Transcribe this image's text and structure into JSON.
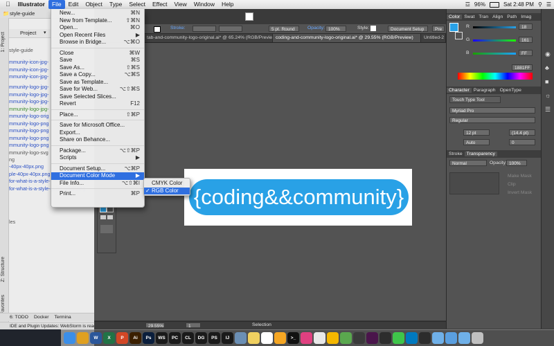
{
  "menubar": {
    "app": "Illustrator",
    "items": [
      "File",
      "Edit",
      "Object",
      "Type",
      "Select",
      "Effect",
      "View",
      "Window",
      "Help"
    ],
    "active": "File",
    "battery": "96%",
    "clock": "Sat 2:48 PM"
  },
  "webstorm": {
    "tab": "style-guide",
    "project_label": "Project",
    "files": [
      {
        "name": "style-guide",
        "cls": "grey"
      },
      {
        "name": "mmunity-icon-jpg-",
        "cls": "blue"
      },
      {
        "name": "mmunity-icon-jpg-",
        "cls": "blue"
      },
      {
        "name": "mmunity-icon-jpg-",
        "cls": "blue"
      },
      {
        "name": "mmunity-logo-jpg-",
        "cls": "blue"
      },
      {
        "name": "mmunity-logo-jpg-",
        "cls": "blue"
      },
      {
        "name": "mmunity-logo-jpg-",
        "cls": "blue"
      },
      {
        "name": "mmunity-logo-jpg-",
        "cls": "green"
      },
      {
        "name": "mmunity-logo-orig",
        "cls": "blue"
      },
      {
        "name": "mmunity-logo-png",
        "cls": "blue"
      },
      {
        "name": "mmunity-logo-png",
        "cls": "blue"
      },
      {
        "name": "mmunity-logo-png",
        "cls": "blue"
      },
      {
        "name": "mmunity-logo-png",
        "cls": "blue"
      },
      {
        "name": "mmunity-logo-svg",
        "cls": "grey"
      },
      {
        "name": "ng",
        "cls": "grey"
      },
      {
        "name": "-40px-40px.png",
        "cls": "blue"
      },
      {
        "name": "ple-40px-40px.png",
        "cls": "blue"
      },
      {
        "name": "for-what-is-a-style-",
        "cls": "blue"
      },
      {
        "name": "for-what-is-a-style-guide-small.png",
        "cls": "blue"
      },
      {
        "name": "les",
        "cls": "grey"
      }
    ],
    "side_labels": [
      "1: Project",
      "Z: Structure",
      "2: Favorites"
    ],
    "bottom_tabs": [
      "6: TODO",
      "Docker",
      "Termina"
    ],
    "status": "IDE and Plugin Updates: WebStorm is read"
  },
  "illustrator": {
    "control": {
      "stroke_label": "Stroke:",
      "pt_round": "5 pt. Round",
      "opacity_label": "Opacity:",
      "opacity": "100%",
      "style_label": "Style:",
      "doc_setup": "Document Setup",
      "pre": "Pre"
    },
    "tabs": [
      {
        "label": "tab-and-community-logo-original.ai* @ 65.24% (RGB/Preview)",
        "on": false
      },
      {
        "label": "coding-and-community-logo-original.ai* @ 29.55% (RGB/Preview)",
        "on": true
      },
      {
        "label": "Untitled-2",
        "on": false
      }
    ],
    "logo_text": "{coding&&community}",
    "logo_color": "#29a1e6",
    "zoom": "29.55%",
    "page": "1",
    "status_mode": "Selection"
  },
  "panels": {
    "color_tabs": [
      "Color",
      "Swat",
      "Tran",
      "Align",
      "Path",
      "Imag"
    ],
    "rgb": {
      "R": "18",
      "G": "161",
      "B": "FF"
    },
    "hex": "1881FF",
    "char_tabs": [
      "Character",
      "Paragraph",
      "OpenType"
    ],
    "touch_type": "Touch Type Tool",
    "font": "Myriad Pro",
    "style": "Regular",
    "size": "12 pt",
    "leading": "(14.4 pt)",
    "kerning": "Auto",
    "tracking": "0",
    "trans_tabs": [
      "Stroke",
      "Transparency"
    ],
    "blend": "Normal",
    "opacity_label": "Opacity:",
    "opacity": "100%",
    "make_mask": "Make Mask",
    "clip": "Clip",
    "invert_mask": "Invert Mask"
  },
  "file_menu": [
    {
      "label": "New...",
      "shortcut": "⌘N"
    },
    {
      "label": "New from Template...",
      "shortcut": "⇧⌘N"
    },
    {
      "label": "Open...",
      "shortcut": "⌘O"
    },
    {
      "label": "Open Recent Files",
      "shortcut": "▶"
    },
    {
      "label": "Browse in Bridge...",
      "shortcut": "⌥⌘O"
    },
    {
      "sep": true
    },
    {
      "label": "Close",
      "shortcut": "⌘W"
    },
    {
      "label": "Save",
      "shortcut": "⌘S"
    },
    {
      "label": "Save As...",
      "shortcut": "⇧⌘S"
    },
    {
      "label": "Save a Copy...",
      "shortcut": "⌥⌘S"
    },
    {
      "label": "Save as Template...",
      "shortcut": ""
    },
    {
      "label": "Save for Web...",
      "shortcut": "⌥⇧⌘S"
    },
    {
      "label": "Save Selected Slices...",
      "shortcut": ""
    },
    {
      "label": "Revert",
      "shortcut": "F12"
    },
    {
      "sep": true
    },
    {
      "label": "Place...",
      "shortcut": "⇧⌘P"
    },
    {
      "sep": true
    },
    {
      "label": "Save for Microsoft Office...",
      "shortcut": ""
    },
    {
      "label": "Export...",
      "shortcut": ""
    },
    {
      "label": "Share on Behance...",
      "shortcut": ""
    },
    {
      "sep": true
    },
    {
      "label": "Package...",
      "shortcut": "⌥⇧⌘P"
    },
    {
      "label": "Scripts",
      "shortcut": "▶"
    },
    {
      "sep": true
    },
    {
      "label": "Document Setup...",
      "shortcut": "⌥⌘P"
    },
    {
      "label": "Document Color Mode",
      "shortcut": "▶",
      "hl": true
    },
    {
      "label": "File Info...",
      "shortcut": "⌥⇧⌘I"
    },
    {
      "sep": true
    },
    {
      "label": "Print...",
      "shortcut": "⌘P"
    }
  ],
  "submenu": [
    {
      "label": "CMYK Color",
      "checked": false
    },
    {
      "label": "RGB Color",
      "checked": true
    }
  ],
  "dock": [
    {
      "name": "finder-icon",
      "txt": "",
      "c": "#3b8ee8"
    },
    {
      "name": "chrome-icon",
      "txt": "",
      "c": "#e0a020"
    },
    {
      "name": "word-icon",
      "txt": "W",
      "c": "#2b579a"
    },
    {
      "name": "excel-icon",
      "txt": "X",
      "c": "#217346"
    },
    {
      "name": "powerpoint-icon",
      "txt": "P",
      "c": "#d24726"
    },
    {
      "name": "illustrator-icon",
      "txt": "Ai",
      "c": "#3a1f00"
    },
    {
      "name": "photoshop-icon",
      "txt": "Ps",
      "c": "#0a1e3c"
    },
    {
      "name": "webstorm-icon",
      "txt": "WS",
      "c": "#1a1a1a"
    },
    {
      "name": "pycharm-icon",
      "txt": "PC",
      "c": "#1a1a1a"
    },
    {
      "name": "clion-icon",
      "txt": "CL",
      "c": "#1a1a1a"
    },
    {
      "name": "datagrip-icon",
      "txt": "DG",
      "c": "#1a1a1a"
    },
    {
      "name": "phpstorm-icon",
      "txt": "PS",
      "c": "#1a1a1a"
    },
    {
      "name": "intellij-icon",
      "txt": "IJ",
      "c": "#1a1a1a"
    },
    {
      "name": "app-icon",
      "txt": "",
      "c": "#6b8fb5"
    },
    {
      "name": "notes-icon",
      "txt": "",
      "c": "#f0d060"
    },
    {
      "name": "calendar-icon",
      "txt": "",
      "c": "#ffffff"
    },
    {
      "name": "pages-icon",
      "txt": "",
      "c": "#f5a623"
    },
    {
      "name": "terminal-icon",
      "txt": ">_",
      "c": "#111111"
    },
    {
      "name": "music-icon",
      "txt": "",
      "c": "#e04080"
    },
    {
      "name": "photos-icon",
      "txt": "",
      "c": "#e8e8e8"
    },
    {
      "name": "sketch-icon",
      "txt": "",
      "c": "#f5b700"
    },
    {
      "name": "maps-icon",
      "txt": "",
      "c": "#5aa84e"
    },
    {
      "name": "audio-icon",
      "txt": "",
      "c": "#3a3a3a"
    },
    {
      "name": "slack-icon",
      "txt": "",
      "c": "#4a154b"
    },
    {
      "name": "chat-icon",
      "txt": "",
      "c": "#2d2d2d"
    },
    {
      "name": "messages-icon",
      "txt": "",
      "c": "#3fc54a"
    },
    {
      "name": "trello-icon",
      "txt": "",
      "c": "#0079bf"
    },
    {
      "name": "vpn-icon",
      "txt": "",
      "c": "#2c2c2c"
    },
    {
      "name": "folder-icon",
      "txt": "",
      "c": "#6fb0e8"
    },
    {
      "name": "downloads-icon",
      "txt": "",
      "c": "#5a9fe0"
    },
    {
      "name": "documents-icon",
      "txt": "",
      "c": "#6fb0e8"
    },
    {
      "name": "trash-icon",
      "txt": "",
      "c": "#c0c0c0"
    }
  ]
}
